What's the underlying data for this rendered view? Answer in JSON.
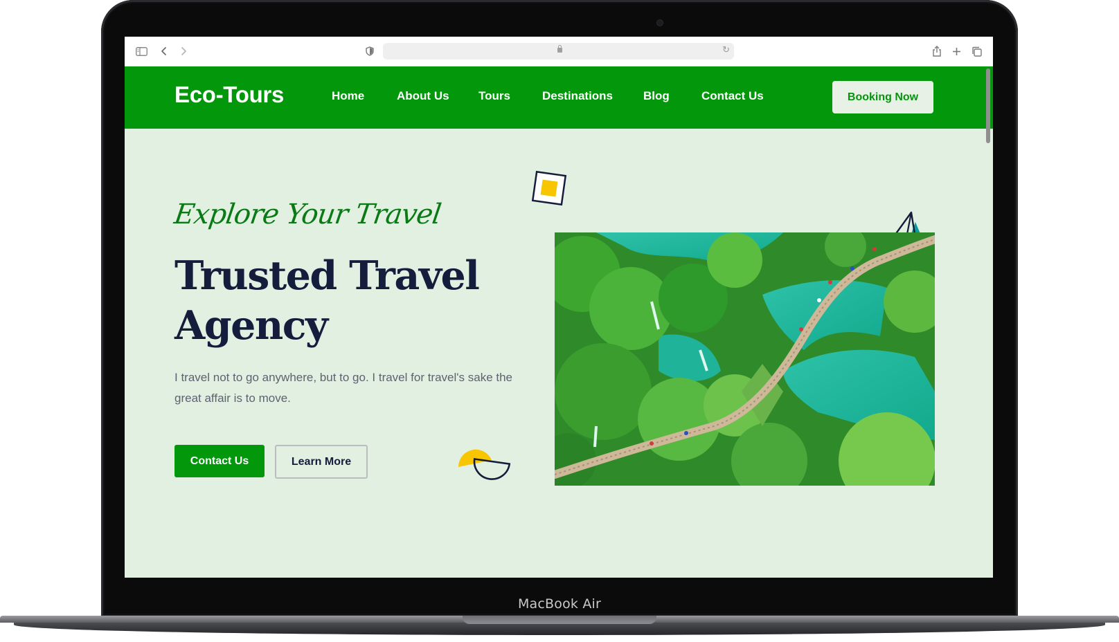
{
  "device": {
    "label": "MacBook Air"
  },
  "browser": {
    "url": "",
    "icons": [
      "sidebar-icon",
      "back-icon",
      "forward-icon",
      "shield-icon",
      "lock-icon",
      "reload-icon",
      "share-icon",
      "new-tab-icon",
      "tabs-icon"
    ]
  },
  "site": {
    "logo": "Eco-Tours",
    "nav": [
      "Home",
      "About Us",
      "Tours",
      "Destinations",
      "Blog",
      "Contact Us"
    ],
    "cta": "Booking Now"
  },
  "hero": {
    "script_title": "Explore Your Travel",
    "title": "Trusted Travel Agency",
    "description": "I travel not to go anywhere, but to go. I travel for travel's sake the great affair is to move.",
    "primary_button": "Contact Us",
    "secondary_button": "Learn More"
  },
  "colors": {
    "brand_green": "#03980b",
    "hero_bg": "#e2f0e1",
    "heading_navy": "#141d3c",
    "accent_yellow": "#f7c600",
    "accent_teal": "#0e9c9a"
  }
}
